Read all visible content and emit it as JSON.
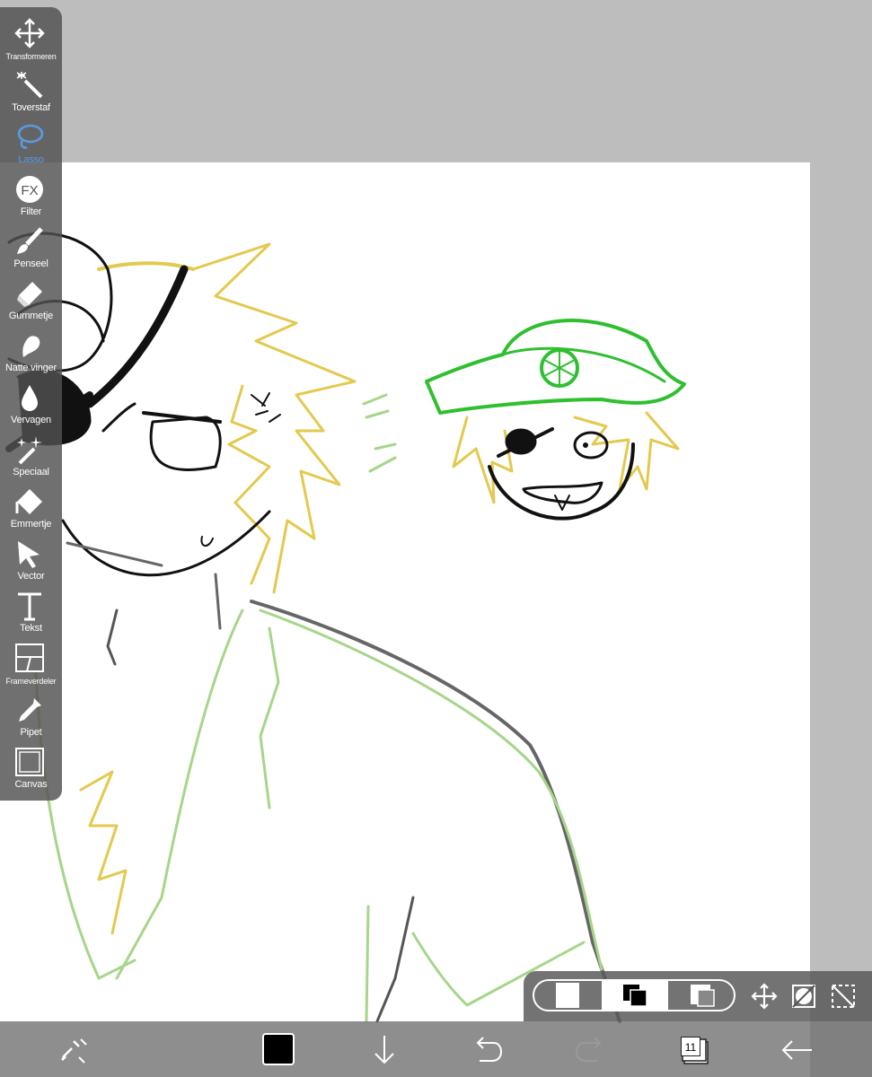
{
  "app": {
    "toolbar": {
      "tools": [
        {
          "id": "transform",
          "label": "Transformeren",
          "icon": "move-arrows-icon"
        },
        {
          "id": "magic-wand",
          "label": "Toverstaf",
          "icon": "magic-wand-icon"
        },
        {
          "id": "lasso",
          "label": "Lasso",
          "icon": "lasso-icon",
          "active": true
        },
        {
          "id": "filter",
          "label": "Filter",
          "icon": "fx-icon"
        },
        {
          "id": "brush",
          "label": "Penseel",
          "icon": "brush-icon"
        },
        {
          "id": "eraser",
          "label": "Gummetje",
          "icon": "eraser-icon"
        },
        {
          "id": "smudge",
          "label": "Natte vinger",
          "icon": "smudge-finger-icon"
        },
        {
          "id": "blur",
          "label": "Vervagen",
          "icon": "water-drop-icon"
        },
        {
          "id": "special",
          "label": "Speciaal",
          "icon": "sparkle-brush-icon"
        },
        {
          "id": "bucket",
          "label": "Emmertje",
          "icon": "paint-bucket-icon"
        },
        {
          "id": "vector",
          "label": "Vector",
          "icon": "cursor-arrow-icon"
        },
        {
          "id": "text",
          "label": "Tekst",
          "icon": "text-t-icon"
        },
        {
          "id": "frame",
          "label": "Frameverdeler",
          "icon": "frame-divider-icon"
        },
        {
          "id": "eyedropper",
          "label": "Pipet",
          "icon": "eyedropper-icon"
        },
        {
          "id": "canvas",
          "label": "Canvas",
          "icon": "canvas-frame-icon"
        }
      ]
    },
    "bottom_bar": {
      "current_color": "#000000",
      "layer_count": "11"
    },
    "colors": {
      "canvas_bg": "#ffffff",
      "workspace_bg": "#bdbdbd",
      "active_tool": "#5a9be0",
      "sketch_green": "#2fbf2f",
      "sketch_yellow": "#e3c94e",
      "sketch_light_green": "#a6d68a"
    }
  }
}
